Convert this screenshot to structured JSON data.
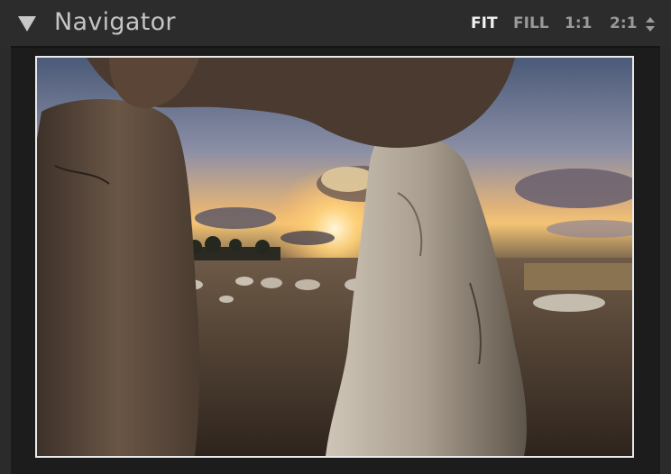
{
  "panel": {
    "title": "Navigator",
    "collapse_icon": "triangle-down-icon"
  },
  "zoom": {
    "fit": "FIT",
    "fill": "FILL",
    "one_to_one": "1:1",
    "two_to_one": "2:1",
    "active": "FIT",
    "stepper_icon": "updown-arrows-icon"
  },
  "preview": {
    "description_icon": "image-thumbnail",
    "accent_border": "#e9e9e9"
  }
}
